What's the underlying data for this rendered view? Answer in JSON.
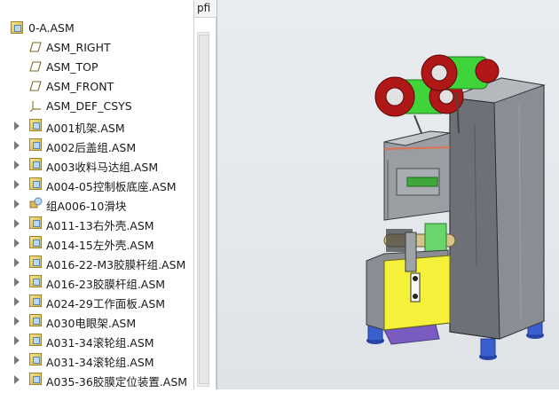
{
  "tree": {
    "column_header": "pfi",
    "root": {
      "label": "0-A.ASM",
      "icon": "assembly-icon"
    },
    "features": [
      {
        "label": "ASM_RIGHT",
        "icon": "datum-plane-icon"
      },
      {
        "label": "ASM_TOP",
        "icon": "datum-plane-icon"
      },
      {
        "label": "ASM_FRONT",
        "icon": "datum-plane-icon"
      },
      {
        "label": "ASM_DEF_CSYS",
        "icon": "coordinate-system-icon"
      }
    ],
    "components": [
      {
        "label": "A001机架.ASM",
        "icon": "assembly-icon"
      },
      {
        "label": "A002后盖组.ASM",
        "icon": "assembly-icon"
      },
      {
        "label": "A003收料马达组.ASM",
        "icon": "assembly-icon"
      },
      {
        "label": "A004-05控制板底座.ASM",
        "icon": "assembly-icon"
      },
      {
        "label": "组A006-10滑块",
        "icon": "group-icon"
      },
      {
        "label": "A011-13右外壳.ASM",
        "icon": "assembly-icon"
      },
      {
        "label": "A014-15左外壳.ASM",
        "icon": "assembly-icon"
      },
      {
        "label": "A016-22-M3胶膜杆组.ASM",
        "icon": "assembly-icon"
      },
      {
        "label": "A016-23胶膜杆组.ASM",
        "icon": "assembly-icon"
      },
      {
        "label": "A024-29工作面板.ASM",
        "icon": "assembly-icon"
      },
      {
        "label": "A030电眼架.ASM",
        "icon": "assembly-icon"
      },
      {
        "label": "A031-34滚轮组.ASM",
        "icon": "assembly-icon"
      },
      {
        "label": "A031-34滚轮组.ASM",
        "icon": "assembly-icon"
      },
      {
        "label": "A035-36胶膜定位装置.ASM",
        "icon": "assembly-icon"
      }
    ]
  },
  "viewport": {
    "model": "sealing-machine-3d-model",
    "colors": {
      "background": "#e6e9ec",
      "cabinet": "#8a8d93",
      "roll_film": "#3fd53a",
      "flange_red": "#b01818",
      "front_panel_yellow": "#f5f03a",
      "feet_blue": "#3458c8",
      "base_purple": "#7a5cc0"
    }
  }
}
